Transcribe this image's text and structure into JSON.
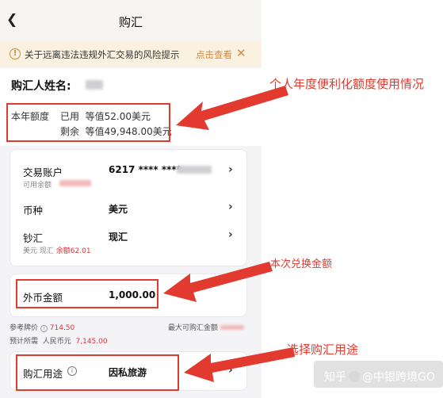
{
  "header": {
    "back_icon": "chevron-left-icon",
    "title": "购汇"
  },
  "notice": {
    "icon": "info-circle-icon",
    "text": "关于远离违法违规外汇交易的风险提示",
    "link": "点击查看",
    "close_icon": "close-icon",
    "accent": "#d7893a"
  },
  "buyer": {
    "label": "购汇人姓名:"
  },
  "quota": {
    "label": "本年额度",
    "used_label": "已用",
    "used_value": "等值52.00美元",
    "remaining_label": "剩余",
    "remaining_value": "等值49,948.00美元"
  },
  "account": {
    "label": "交易账户",
    "number_prefix": "6217 **** ****",
    "available_label": "可用余额"
  },
  "currency": {
    "label": "币种",
    "value": "美元"
  },
  "cash_type": {
    "label": "钞汇",
    "value": "现汇",
    "sub_currency": "美元",
    "sub_type": "现汇",
    "balance_label": "余额62.01"
  },
  "amount": {
    "label": "外币金额",
    "value": "1,000.00"
  },
  "rates": {
    "ref_label": "参考牌价",
    "ref_icon": "info-circle-icon",
    "ref_value": "714.50",
    "max_label": "最大可购汇金额",
    "est_label": "预计所需",
    "est_currency": "人民币元",
    "est_value": "7,145.00"
  },
  "purpose": {
    "label": "购汇用途",
    "icon": "info-circle-icon",
    "value": "因私旅游"
  },
  "annotations": {
    "quota_note": "个人年度便利化额度使用情况",
    "amount_note": "本次兑换金额",
    "purpose_note": "选择购汇用途",
    "color": "#e23a2e"
  },
  "watermark": {
    "text_a": "知乎",
    "text_b": "@中银跨境GO"
  }
}
